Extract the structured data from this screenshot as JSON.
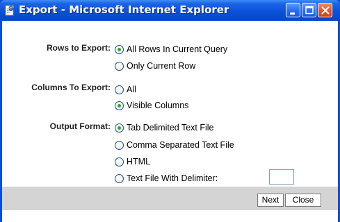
{
  "window": {
    "title": "Export - Microsoft Internet Explorer",
    "icon": "ie-document-icon",
    "controls": [
      "minimize-icon",
      "maximize-icon",
      "close-icon"
    ]
  },
  "form": {
    "rows": {
      "label": "Rows to Export:",
      "options": [
        {
          "label": "All Rows In Current Query",
          "checked": true
        },
        {
          "label": "Only Current Row",
          "checked": false
        }
      ]
    },
    "columns": {
      "label": "Columns To Export:",
      "options": [
        {
          "label": "All",
          "checked": false
        },
        {
          "label": "Visible Columns",
          "checked": true
        }
      ]
    },
    "format": {
      "label": "Output Format:",
      "options": [
        {
          "label": "Tab Delimited Text File",
          "checked": true
        },
        {
          "label": "Comma Separated Text File",
          "checked": false
        },
        {
          "label": "HTML",
          "checked": false
        },
        {
          "label": "Text File With Delimiter:",
          "checked": false
        }
      ],
      "delimiter_value": ""
    }
  },
  "buttons": {
    "next": "Next",
    "close": "Close"
  },
  "colors": {
    "title_bar": "#0a52d8",
    "close_button": "#e0542a",
    "radio_dot": "#2fa82f",
    "footer": "#d4d4d4"
  }
}
